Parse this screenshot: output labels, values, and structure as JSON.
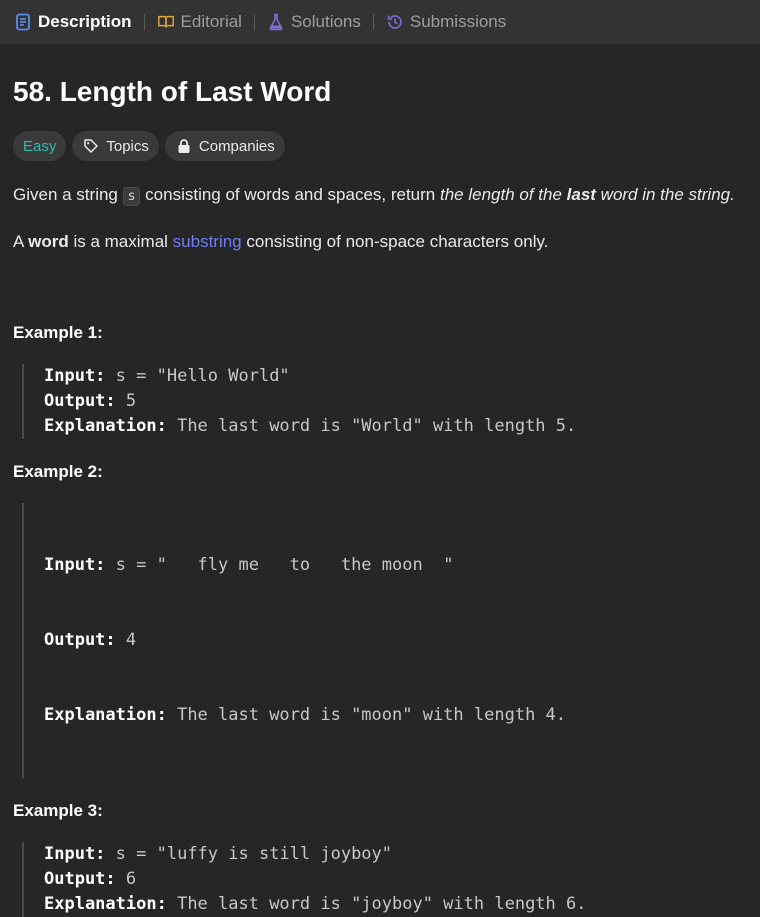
{
  "tabs": [
    {
      "label": "Description",
      "icon": "description-icon"
    },
    {
      "label": "Editorial",
      "icon": "book-icon"
    },
    {
      "label": "Solutions",
      "icon": "flask-icon"
    },
    {
      "label": "Submissions",
      "icon": "history-icon"
    }
  ],
  "problem": {
    "title": "58. Length of Last Word",
    "difficulty": "Easy",
    "topics_label": "Topics",
    "companies_label": "Companies"
  },
  "description": {
    "line1_a": "Given a string ",
    "line1_code": "s",
    "line1_b": " consisting of words and spaces, return ",
    "line1_em_a": "the length of the ",
    "line1_em_bold": "last",
    "line1_em_b": " word in the string.",
    "line2_a": "A ",
    "line2_bold": "word",
    "line2_b": " is a maximal ",
    "line2_link": "substring",
    "line2_c": " consisting of non-space characters only."
  },
  "examples": [
    {
      "title": "Example 1:",
      "input": "s = \"Hello World\"",
      "output": "5",
      "explanation": "The last word is \"World\" with length 5."
    },
    {
      "title": "Example 2:",
      "input": "s = \"   fly me   to   the moon  \"",
      "output": "4",
      "explanation": "The last word is \"moon\" with length 4."
    },
    {
      "title": "Example 3:",
      "input": "s = \"luffy is still joyboy\"",
      "output": "6",
      "explanation": "The last word is \"joyboy\" with length 6."
    }
  ],
  "labels": {
    "input": "Input:",
    "output": "Output:",
    "explanation": "Explanation:"
  },
  "colors": {
    "background": "#262626",
    "tabbar": "#333333",
    "easy": "#2cbbb0",
    "link": "#6f7cf5",
    "description_icon": "#5b8def",
    "flask_icon": "#7c6fd6"
  }
}
